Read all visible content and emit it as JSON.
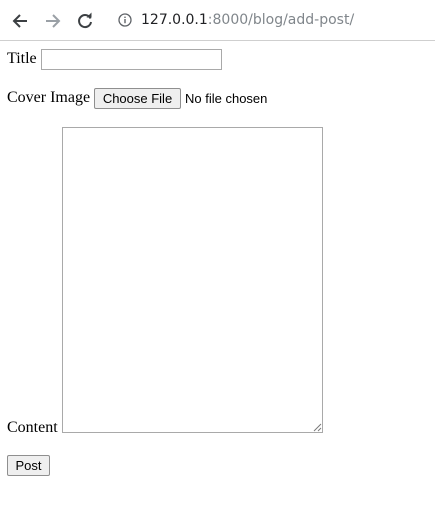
{
  "browser": {
    "url_host": "127.0.0.1",
    "url_path": ":8000/blog/add-post/",
    "icons": {
      "back": "back-arrow-icon",
      "forward": "forward-arrow-icon",
      "reload": "reload-icon",
      "site_info": "info-icon"
    }
  },
  "form": {
    "title_label": "Title",
    "title_value": "",
    "cover_label": "Cover Image",
    "choose_file_label": "Choose File",
    "file_status": "No file chosen",
    "content_label": "Content",
    "content_value": "",
    "submit_label": "Post"
  }
}
